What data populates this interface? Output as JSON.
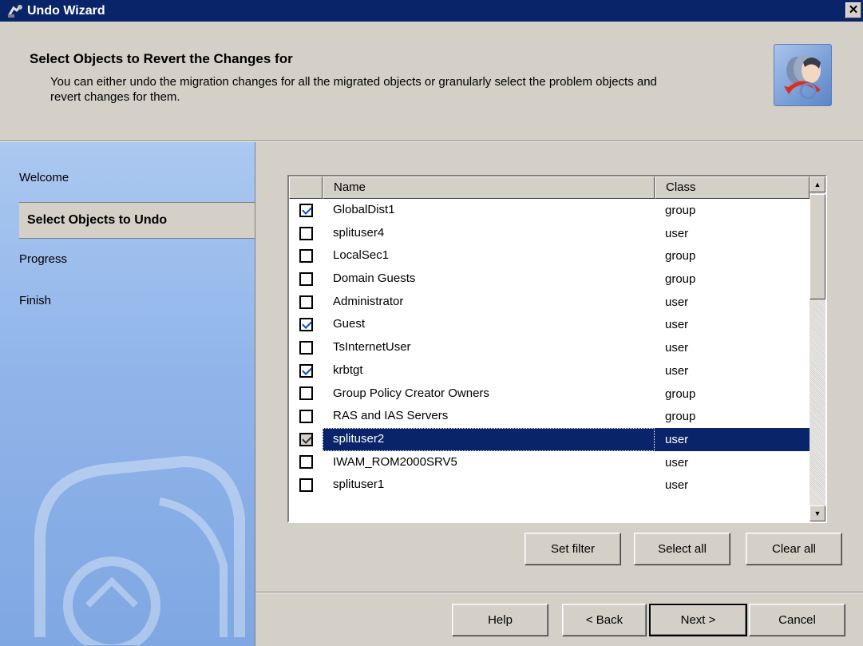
{
  "window": {
    "title": "Undo Wizard",
    "close_glyph": "✕"
  },
  "header": {
    "title": "Select Objects to Revert the Changes for",
    "description": "You can either undo the migration changes for all the migrated objects or granularly select the problem objects and revert changes for them."
  },
  "sidebar": {
    "items": [
      {
        "label": "Welcome",
        "active": false
      },
      {
        "label": "Select Objects to Undo",
        "active": true
      },
      {
        "label": "Progress",
        "active": false
      },
      {
        "label": "Finish",
        "active": false
      }
    ]
  },
  "list": {
    "columns": [
      "",
      "Name",
      "Class"
    ],
    "rows": [
      {
        "checked": true,
        "name": "GlobalDist1",
        "class": "group",
        "selected": false
      },
      {
        "checked": false,
        "name": "splituser4",
        "class": "user",
        "selected": false
      },
      {
        "checked": false,
        "name": "LocalSec1",
        "class": "group",
        "selected": false
      },
      {
        "checked": false,
        "name": "Domain Guests",
        "class": "group",
        "selected": false
      },
      {
        "checked": false,
        "name": "Administrator",
        "class": "user",
        "selected": false
      },
      {
        "checked": true,
        "name": "Guest",
        "class": "user",
        "selected": false
      },
      {
        "checked": false,
        "name": "TsInternetUser",
        "class": "user",
        "selected": false
      },
      {
        "checked": true,
        "name": "krbtgt",
        "class": "user",
        "selected": false
      },
      {
        "checked": false,
        "name": "Group Policy Creator Owners",
        "class": "group",
        "selected": false
      },
      {
        "checked": false,
        "name": "RAS and IAS Servers",
        "class": "group",
        "selected": false
      },
      {
        "checked": true,
        "name": "splituser2",
        "class": "user",
        "selected": true
      },
      {
        "checked": false,
        "name": "IWAM_ROM2000SRV5",
        "class": "user",
        "selected": false
      },
      {
        "checked": false,
        "name": "splituser1",
        "class": "user",
        "selected": false
      }
    ]
  },
  "filter_buttons": {
    "set_filter": "Set filter",
    "select_all": "Select all",
    "clear_all": "Clear all"
  },
  "nav_buttons": {
    "help": "Help",
    "back": "< Back",
    "next": "Next >",
    "cancel": "Cancel"
  },
  "colors": {
    "title_bar": "#0a246a",
    "selection": "#0a246a",
    "face": "#d4d0c8",
    "sidebar": "#91b5ea"
  }
}
